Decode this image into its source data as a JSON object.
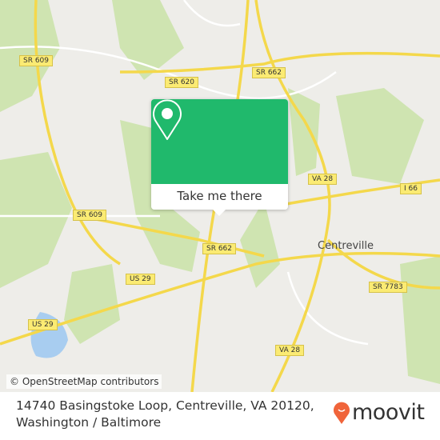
{
  "map": {
    "road_labels": [
      "SR 609",
      "SR 620",
      "SR 662",
      "VA 28",
      "I 66",
      "SR 609",
      "SR 662",
      "US 29",
      "US 29",
      "SR 7783",
      "VA 28"
    ],
    "place_labels": [
      "Centreville"
    ],
    "attribution": "© OpenStreetMap contributors",
    "colors": {
      "land": "#eeede9",
      "park": "#cfe4b1",
      "road": "#f4d84b",
      "water": "#a8cdf0"
    }
  },
  "popup": {
    "icon": "map-pin-icon",
    "button_label": "Take me there",
    "color": "#20b96c"
  },
  "footer": {
    "address_line1": "14740 Basingstoke Loop, Centreville, VA 20120,",
    "address_line2": "Washington / Baltimore",
    "logo_text": "moovit",
    "logo_color": "#f0643a"
  }
}
